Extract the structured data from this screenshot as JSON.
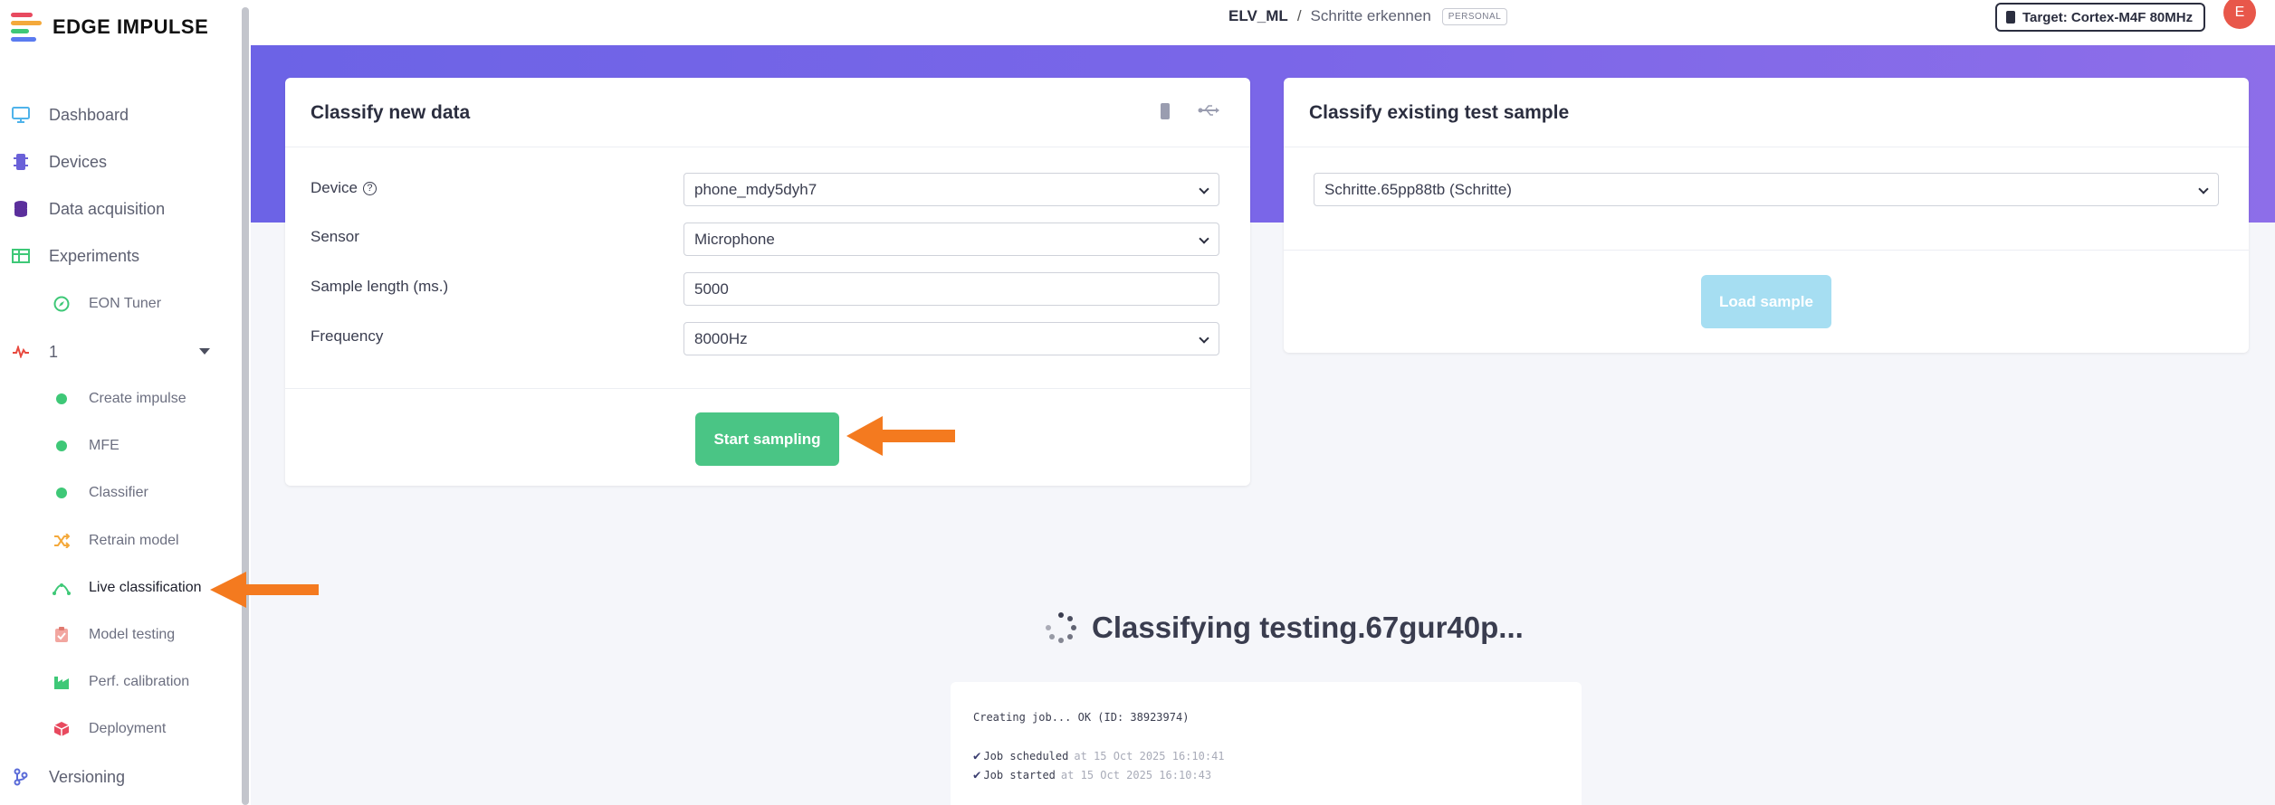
{
  "app": {
    "logo_text": "EDGE IMPULSE",
    "brand_colors": [
      "#e84a5f",
      "#f4a93b",
      "#3ec877",
      "#5a7bf0"
    ]
  },
  "sidebar": {
    "items": [
      {
        "label": "Dashboard",
        "icon": "monitor-icon"
      },
      {
        "label": "Devices",
        "icon": "chip-icon"
      },
      {
        "label": "Data acquisition",
        "icon": "database-icon"
      },
      {
        "label": "Experiments",
        "icon": "table-icon"
      },
      {
        "label": "EON Tuner",
        "icon": "compass-icon"
      },
      {
        "label": "1",
        "icon": "pulse-icon"
      },
      {
        "label": "Create impulse",
        "icon": "dot-icon"
      },
      {
        "label": "MFE",
        "icon": "dot-icon"
      },
      {
        "label": "Classifier",
        "icon": "dot-icon"
      },
      {
        "label": "Retrain model",
        "icon": "shuffle-icon"
      },
      {
        "label": "Live classification",
        "icon": "signal-icon"
      },
      {
        "label": "Model testing",
        "icon": "clipboard-icon"
      },
      {
        "label": "Perf. calibration",
        "icon": "factory-icon"
      },
      {
        "label": "Deployment",
        "icon": "cube-icon"
      },
      {
        "label": "Versioning",
        "icon": "branch-icon"
      }
    ]
  },
  "header": {
    "project": "ELV_ML",
    "separator": "/",
    "page": "Schritte erkennen",
    "badge": "PERSONAL",
    "target": "Target: Cortex-M4F 80MHz",
    "avatar_initial": "E"
  },
  "classify_new": {
    "title": "Classify new data",
    "device_label": "Device",
    "device_help": "?",
    "device_value": "phone_mdy5dyh7",
    "sensor_label": "Sensor",
    "sensor_value": "Microphone",
    "length_label": "Sample length (ms.)",
    "length_value": "5000",
    "frequency_label": "Frequency",
    "frequency_value": "8000Hz",
    "start_button": "Start sampling"
  },
  "classify_existing": {
    "title": "Classify existing test sample",
    "sample_value": "Schritte.65pp88tb (Schritte)",
    "load_button": "Load sample"
  },
  "status": {
    "text": "Classifying testing.67gur40p..."
  },
  "log": {
    "line1": "Creating job... OK (ID: 38923974)",
    "line2_main": "Job scheduled",
    "line2_time": "at 15 Oct 2025 16:10:41",
    "line3_main": "Job started",
    "line3_time": "at 15 Oct 2025 16:10:43"
  },
  "colors": {
    "banner": "#7466e7",
    "green_button": "#4ac585",
    "arrow": "#f47a1f"
  }
}
